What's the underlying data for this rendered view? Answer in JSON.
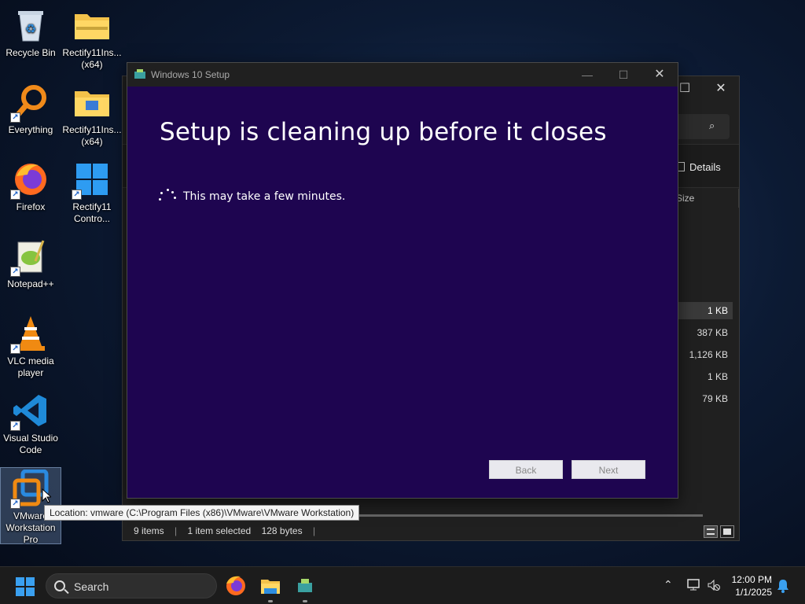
{
  "desktop": {
    "icons": [
      {
        "label": "Recycle Bin",
        "icon": "recycle-bin-icon"
      },
      {
        "label": "Rectify11Ins...\n(x64)",
        "icon": "zip-folder-icon"
      },
      {
        "label": "Everything",
        "icon": "everything-search-icon"
      },
      {
        "label": "Rectify11Ins...\n(x64)",
        "icon": "folder-icon"
      },
      {
        "label": "Firefox",
        "icon": "firefox-icon"
      },
      {
        "label": "Rectify11\nContro...",
        "icon": "windows-logo-icon"
      },
      {
        "label": "Notepad++",
        "icon": "notepadpp-icon"
      },
      {
        "label": "VLC media\nplayer",
        "icon": "vlc-icon"
      },
      {
        "label": "Visual Studio\nCode",
        "icon": "vscode-icon"
      },
      {
        "label": "VMware\nWorkstation\nPro",
        "icon": "vmware-icon"
      }
    ]
  },
  "explorer": {
    "details_label": "Details",
    "size_header": "Size",
    "sizes": [
      "1 KB",
      "387 KB",
      "1,126 KB",
      "1 KB",
      "79 KB"
    ],
    "status": {
      "items": "9 items",
      "selected": "1 item selected",
      "size": "128 bytes"
    }
  },
  "setup": {
    "window_title": "Windows 10 Setup",
    "heading": "Setup is cleaning up before it closes",
    "message": "This may take a few minutes.",
    "back_label": "Back",
    "next_label": "Next",
    "bg_color": "#1e0550"
  },
  "tooltip": {
    "text": "Location: vmware (C:\\Program Files (x86)\\VMware\\VMware Workstation)"
  },
  "taskbar": {
    "search_label": "Search",
    "time": "12:00 PM",
    "date": "1/1/2025"
  }
}
